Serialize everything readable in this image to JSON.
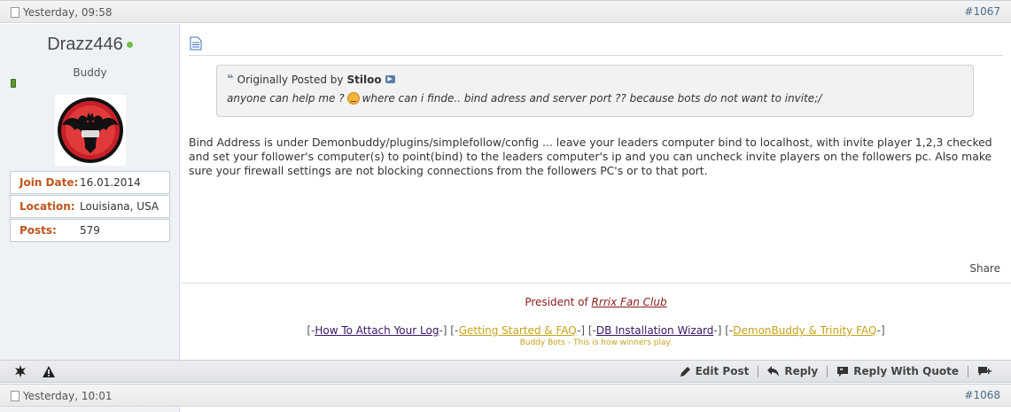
{
  "post1": {
    "date": "Yesterday, 09:58",
    "number": "#1067"
  },
  "user": {
    "name": "Drazz446",
    "title": "Buddy",
    "stats": [
      {
        "label": "Join Date:",
        "value": "16.01.2014"
      },
      {
        "label": "Location:",
        "value": "Louisiana, USA"
      },
      {
        "label": "Posts:",
        "value": "579"
      }
    ]
  },
  "quote": {
    "prefix": "Originally Posted by",
    "author": "Stiloo",
    "text_before": "anyone can help me ?",
    "text_after": "where can i finde.. bind adress and server port ?? because bots do not want to invite;/"
  },
  "message": "Bind Address is under Demonbuddy/plugins/simplefollow/config ... leave your leaders computer bind to localhost, with invite player 1,2,3 checked and set your follower's computer(s) to point(bind) to the leaders computer's ip and you can uncheck invite players on the followers pc. Also make sure your firewall settings are not blocking connections from the followers PC's or to that port.",
  "share_label": "Share",
  "signature": {
    "line1_prefix": "President of",
    "line1_link": "Rrrix Fan Club",
    "links": [
      {
        "label": "How To Attach Your Log",
        "color": "#3a1466"
      },
      {
        "label": "Getting Started & FAQ",
        "color": "#c7a21c"
      },
      {
        "label": "DB Installation Wizard",
        "color": "#3a1466"
      },
      {
        "label": "DemonBuddy & Trinity FAQ",
        "color": "#c7a21c"
      }
    ],
    "tagline": "Buddy Bots - This is how winners play."
  },
  "footer": {
    "edit": "Edit Post",
    "reply": "Reply",
    "reply_quote": "Reply With Quote"
  },
  "post2": {
    "date": "Yesterday, 10:01",
    "number": "#1068"
  }
}
